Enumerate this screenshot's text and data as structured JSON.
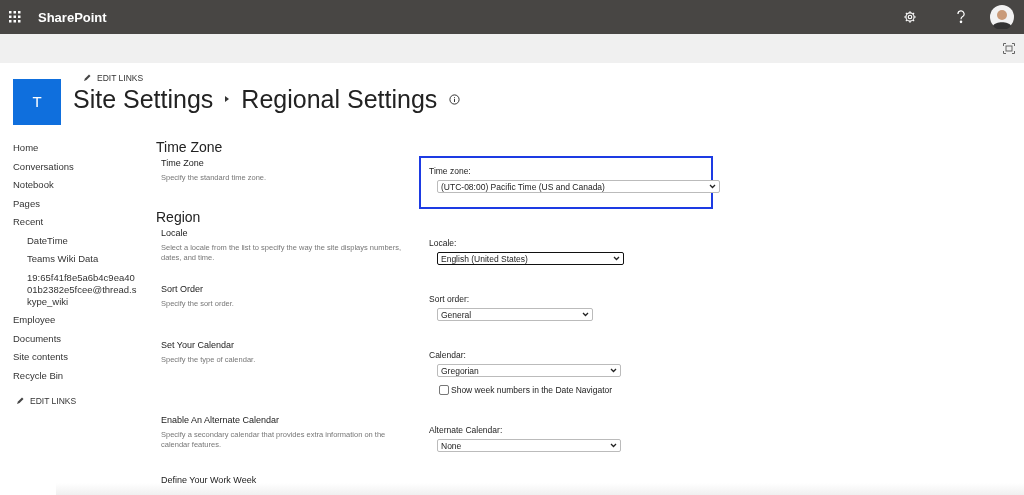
{
  "app_bar": {
    "title": "SharePoint"
  },
  "site": {
    "logo_letter": "T",
    "edit_links": "EDIT LINKS",
    "breadcrumb": [
      "Site Settings",
      "Regional Settings"
    ]
  },
  "nav": {
    "items": [
      {
        "label": "Home"
      },
      {
        "label": "Conversations"
      },
      {
        "label": "Notebook"
      },
      {
        "label": "Pages"
      },
      {
        "label": "Recent",
        "children": [
          {
            "label": "DateTime"
          },
          {
            "label": "Teams Wiki Data"
          },
          {
            "label": "19:65f41f8e5a6b4c9ea4001b2382e5fcee@thread.skype_wiki"
          }
        ]
      },
      {
        "label": "Employee"
      },
      {
        "label": "Documents"
      },
      {
        "label": "Site contents"
      },
      {
        "label": "Recycle Bin"
      }
    ],
    "edit_links": "EDIT LINKS"
  },
  "groups": [
    {
      "heading": "Time Zone",
      "sections": [
        {
          "title": "Time Zone",
          "description": "Specify the standard time zone.",
          "highlighted": true,
          "controls": [
            {
              "kind": "select",
              "label": "Time zone:",
              "value": "(UTC-08:00) Pacific Time (US and Canada)",
              "focused": false
            }
          ]
        }
      ]
    },
    {
      "heading": "Region",
      "sections": [
        {
          "title": "Locale",
          "description": "Select a locale from the list to specify the way the site displays numbers, dates, and time.",
          "highlighted": false,
          "controls": [
            {
              "kind": "select",
              "label": "Locale:",
              "value": "English (United States)",
              "focused": true
            }
          ]
        },
        {
          "title": "Sort Order",
          "description": "Specify the sort order.",
          "highlighted": false,
          "controls": [
            {
              "kind": "select",
              "label": "Sort order:",
              "value": "General",
              "focused": false
            }
          ]
        },
        {
          "title": "Set Your Calendar",
          "description": "Specify the type of calendar.",
          "highlighted": false,
          "controls": [
            {
              "kind": "select",
              "label": "Calendar:",
              "value": "Gregorian",
              "focused": false
            },
            {
              "kind": "checkbox",
              "label": "Show week numbers in the Date Navigator",
              "checked": false
            }
          ]
        },
        {
          "title": "Enable An Alternate Calendar",
          "description": "Specify a secondary calendar that provides extra information on the calendar features.",
          "highlighted": false,
          "controls": [
            {
              "kind": "select",
              "label": "Alternate Calendar:",
              "value": "None",
              "focused": false
            }
          ]
        },
        {
          "title": "Define Your Work Week"
        }
      ]
    }
  ]
}
